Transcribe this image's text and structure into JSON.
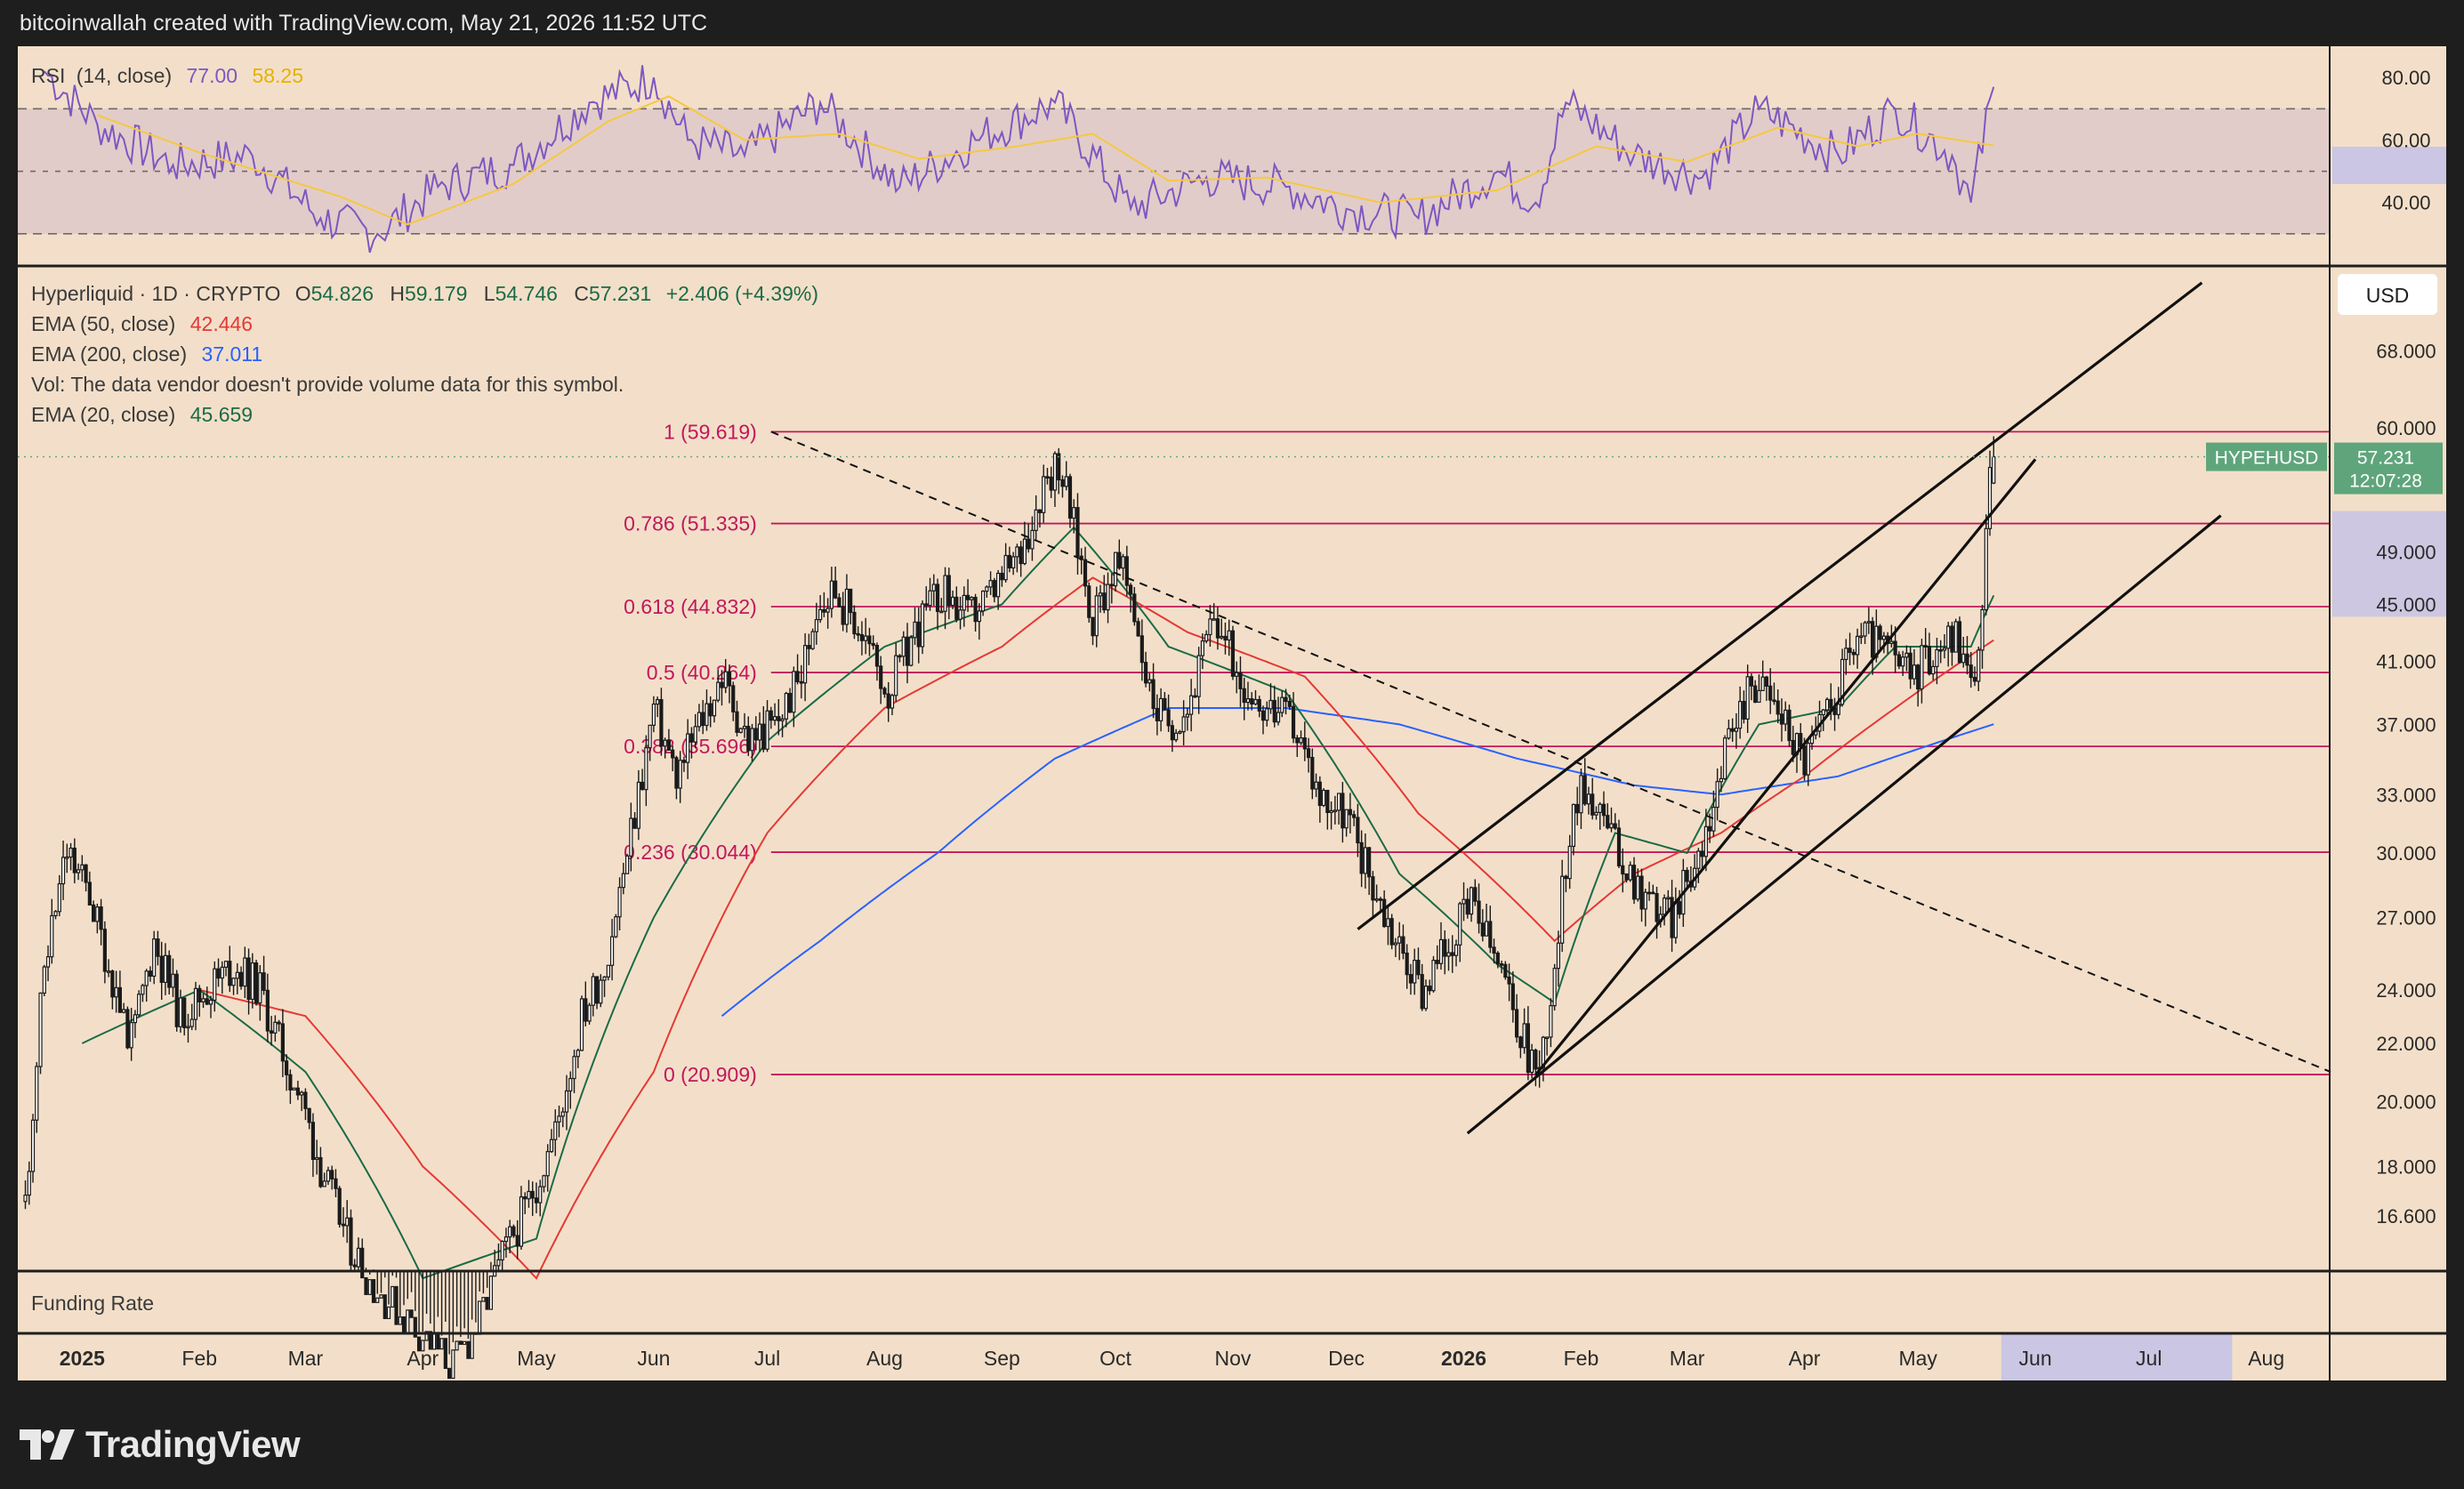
{
  "header": {
    "credit": "bitcoinwallah created with TradingView.com, May 21, 2026 11:52 UTC"
  },
  "footer": {
    "brand": "TradingView"
  },
  "colors": {
    "background": "#f3dfc9",
    "rsi": "#7e57c2",
    "rsi_ma": "#f5c842",
    "ema50": "#e53935",
    "ema200": "#2962ff",
    "ema20": "#1b6b47",
    "fib": "#c2185b",
    "price_label": "#5fa57c",
    "highlight": "#c5c3e6"
  },
  "rsi_panel": {
    "label": "RSI",
    "params": "(14, close)",
    "value": "77.00",
    "ma_value": "58.25",
    "ticks": [
      "80.00",
      "60.00",
      "40.00"
    ]
  },
  "price_panel": {
    "symbol": "Hyperliquid · 1D · CRYPTO",
    "open_label": "O",
    "open": "54.826",
    "high_label": "H",
    "high": "59.179",
    "low_label": "L",
    "low": "54.746",
    "close_label": "C",
    "close": "57.231",
    "change": "+2.406 (+4.39%)",
    "ema50_label": "EMA (50, close)",
    "ema50_value": "42.446",
    "ema200_label": "EMA (200, close)",
    "ema200_value": "37.011",
    "vol_note": "Vol: The data vendor doesn't provide volume data for this symbol.",
    "ema20_label": "EMA (20, close)",
    "ema20_value": "45.659",
    "currency": "USD",
    "ticker_label": "HYPEHUSD",
    "last_price": "57.231",
    "countdown": "12:07:28"
  },
  "funding_panel": {
    "label": "Funding Rate"
  },
  "time_axis": {
    "labels": [
      "2025",
      "Feb",
      "Mar",
      "Apr",
      "May",
      "Jun",
      "Jul",
      "Aug",
      "Sep",
      "Oct",
      "Nov",
      "Dec",
      "2026",
      "Feb",
      "Mar",
      "Apr",
      "May",
      "Jun",
      "Jul",
      "Aug"
    ]
  },
  "chart_data": {
    "type": "candlestick",
    "symbol": "HYPEHUSD",
    "interval": "1D",
    "y_scale": "log",
    "ylim": [
      15.2,
      78
    ],
    "xlim": [
      "2024-12-15",
      "2026-08-18"
    ],
    "price_ticks": [
      "68.000",
      "60.000",
      "49.000",
      "45.000",
      "41.000",
      "37.000",
      "33.000",
      "30.000",
      "27.000",
      "24.000",
      "22.000",
      "20.000",
      "18.000",
      "16.600"
    ],
    "fib_levels": [
      {
        "label": "1 (59.619)",
        "value": 59.619
      },
      {
        "label": "0.786 (51.335)",
        "value": 51.335
      },
      {
        "label": "0.618 (44.832)",
        "value": 44.832
      },
      {
        "label": "0.5 (40.264)",
        "value": 40.264
      },
      {
        "label": "0.382 (35.696)",
        "value": 35.696
      },
      {
        "label": "0.236 (30.044)",
        "value": 30.044
      },
      {
        "label": "0 (20.909)",
        "value": 20.909
      }
    ],
    "fib_range": [
      "2025-07-02",
      "2026-08-18"
    ],
    "close_series": [
      [
        "2024-12-17",
        17
      ],
      [
        "2024-12-22",
        25
      ],
      [
        "2024-12-28",
        30
      ],
      [
        "2025-01-03",
        28
      ],
      [
        "2025-01-08",
        25
      ],
      [
        "2025-01-14",
        22
      ],
      [
        "2025-01-20",
        26
      ],
      [
        "2025-01-27",
        23
      ],
      [
        "2025-02-03",
        24
      ],
      [
        "2025-02-10",
        25
      ],
      [
        "2025-02-17",
        24
      ],
      [
        "2025-02-22",
        22
      ],
      [
        "2025-02-28",
        20
      ],
      [
        "2025-03-05",
        18
      ],
      [
        "2025-03-12",
        16
      ],
      [
        "2025-03-19",
        14.8
      ],
      [
        "2025-03-26",
        14.2
      ],
      [
        "2025-04-02",
        13.6
      ],
      [
        "2025-04-09",
        13
      ],
      [
        "2025-04-16",
        14
      ],
      [
        "2025-04-22",
        15.5
      ],
      [
        "2025-04-29",
        17
      ],
      [
        "2025-05-06",
        19
      ],
      [
        "2025-05-13",
        23
      ],
      [
        "2025-05-19",
        25
      ],
      [
        "2025-05-24",
        29
      ],
      [
        "2025-05-28",
        33
      ],
      [
        "2025-06-01",
        38
      ],
      [
        "2025-06-07",
        34
      ],
      [
        "2025-06-13",
        37
      ],
      [
        "2025-06-19",
        40
      ],
      [
        "2025-06-26",
        36
      ],
      [
        "2025-07-03",
        37
      ],
      [
        "2025-07-10",
        40
      ],
      [
        "2025-07-14",
        45
      ],
      [
        "2025-07-19",
        46
      ],
      [
        "2025-07-26",
        43
      ],
      [
        "2025-08-02",
        39
      ],
      [
        "2025-08-09",
        43
      ],
      [
        "2025-08-16",
        46
      ],
      [
        "2025-08-23",
        44
      ],
      [
        "2025-08-30",
        46
      ],
      [
        "2025-09-06",
        49
      ],
      [
        "2025-09-12",
        55
      ],
      [
        "2025-09-16",
        57
      ],
      [
        "2025-09-20",
        51
      ],
      [
        "2025-09-25",
        44
      ],
      [
        "2025-10-01",
        48
      ],
      [
        "2025-10-05",
        46
      ],
      [
        "2025-10-10",
        39
      ],
      [
        "2025-10-14",
        37
      ],
      [
        "2025-10-20",
        38
      ],
      [
        "2025-10-27",
        44
      ],
      [
        "2025-11-03",
        40
      ],
      [
        "2025-11-10",
        38
      ],
      [
        "2025-11-17",
        37
      ],
      [
        "2025-11-24",
        33
      ],
      [
        "2025-12-01",
        32
      ],
      [
        "2025-12-07",
        29
      ],
      [
        "2025-12-14",
        26
      ],
      [
        "2025-12-21",
        24
      ],
      [
        "2025-12-28",
        26
      ],
      [
        "2026-01-03",
        27.5
      ],
      [
        "2026-01-10",
        25
      ],
      [
        "2026-01-17",
        22
      ],
      [
        "2026-01-21",
        21
      ],
      [
        "2026-01-25",
        25
      ],
      [
        "2026-01-30",
        33
      ],
      [
        "2026-02-04",
        33
      ],
      [
        "2026-02-11",
        30
      ],
      [
        "2026-02-18",
        28
      ],
      [
        "2026-02-25",
        27
      ],
      [
        "2026-03-04",
        30
      ],
      [
        "2026-03-11",
        35
      ],
      [
        "2026-03-18",
        40
      ],
      [
        "2026-03-25",
        38
      ],
      [
        "2026-04-01",
        35
      ],
      [
        "2026-04-08",
        38
      ],
      [
        "2026-04-15",
        43
      ],
      [
        "2026-04-22",
        42
      ],
      [
        "2026-04-29",
        40
      ],
      [
        "2026-05-06",
        42
      ],
      [
        "2026-05-11",
        43
      ],
      [
        "2026-05-15",
        39.5
      ],
      [
        "2026-05-18",
        44
      ],
      [
        "2026-05-19",
        50
      ],
      [
        "2026-05-20",
        54.8
      ],
      [
        "2026-05-21",
        57.231
      ]
    ],
    "ema20": [
      [
        "2025-01-01",
        22
      ],
      [
        "2025-02-01",
        24
      ],
      [
        "2025-03-01",
        21
      ],
      [
        "2025-04-01",
        15
      ],
      [
        "2025-05-01",
        16
      ],
      [
        "2025-06-01",
        27
      ],
      [
        "2025-07-01",
        36
      ],
      [
        "2025-08-01",
        42
      ],
      [
        "2025-09-01",
        45
      ],
      [
        "2025-09-20",
        51
      ],
      [
        "2025-10-15",
        42
      ],
      [
        "2025-11-15",
        39
      ],
      [
        "2025-12-15",
        29
      ],
      [
        "2026-01-10",
        25
      ],
      [
        "2026-01-25",
        23.5
      ],
      [
        "2026-02-10",
        31
      ],
      [
        "2026-03-01",
        30
      ],
      [
        "2026-03-20",
        37
      ],
      [
        "2026-04-10",
        38
      ],
      [
        "2026-04-25",
        42
      ],
      [
        "2026-05-15",
        42
      ],
      [
        "2026-05-21",
        45.659
      ]
    ],
    "ema50": [
      [
        "2025-02-01",
        24
      ],
      [
        "2025-03-01",
        23
      ],
      [
        "2025-04-01",
        18
      ],
      [
        "2025-05-01",
        15
      ],
      [
        "2025-06-01",
        21
      ],
      [
        "2025-07-01",
        31
      ],
      [
        "2025-08-01",
        38
      ],
      [
        "2025-09-01",
        42
      ],
      [
        "2025-09-25",
        47
      ],
      [
        "2025-10-20",
        43
      ],
      [
        "2025-11-20",
        40
      ],
      [
        "2025-12-20",
        32
      ],
      [
        "2026-01-25",
        26
      ],
      [
        "2026-02-15",
        29
      ],
      [
        "2026-03-10",
        31
      ],
      [
        "2026-04-01",
        34
      ],
      [
        "2026-04-25",
        38
      ],
      [
        "2026-05-21",
        42.446
      ]
    ],
    "ema200": [
      [
        "2025-06-19",
        23
      ],
      [
        "2025-07-15",
        26
      ],
      [
        "2025-08-15",
        30
      ],
      [
        "2025-09-15",
        35
      ],
      [
        "2025-10-15",
        38
      ],
      [
        "2025-11-15",
        38
      ],
      [
        "2025-12-15",
        37
      ],
      [
        "2026-01-15",
        35
      ],
      [
        "2026-02-15",
        33.5
      ],
      [
        "2026-03-10",
        33
      ],
      [
        "2026-04-10",
        34
      ],
      [
        "2026-05-21",
        37.011
      ]
    ],
    "rsi_series": [
      [
        "2024-12-22",
        82
      ],
      [
        "2025-01-05",
        65
      ],
      [
        "2025-01-25",
        52
      ],
      [
        "2025-02-15",
        55
      ],
      [
        "2025-03-05",
        35
      ],
      [
        "2025-03-20",
        30
      ],
      [
        "2025-04-05",
        45
      ],
      [
        "2025-04-25",
        52
      ],
      [
        "2025-05-15",
        72
      ],
      [
        "2025-06-01",
        80
      ],
      [
        "2025-06-10",
        60
      ],
      [
        "2025-06-25",
        55
      ],
      [
        "2025-07-15",
        72
      ],
      [
        "2025-08-05",
        45
      ],
      [
        "2025-08-25",
        60
      ],
      [
        "2025-09-15",
        72
      ],
      [
        "2025-10-05",
        38
      ],
      [
        "2025-10-25",
        48
      ],
      [
        "2025-11-15",
        45
      ],
      [
        "2025-12-01",
        38
      ],
      [
        "2025-12-20",
        35
      ],
      [
        "2026-01-10",
        50
      ],
      [
        "2026-01-20",
        40
      ],
      [
        "2026-01-28",
        72
      ],
      [
        "2026-02-15",
        55
      ],
      [
        "2026-03-05",
        48
      ],
      [
        "2026-03-20",
        70
      ],
      [
        "2026-04-10",
        55
      ],
      [
        "2026-04-25",
        70
      ],
      [
        "2026-05-10",
        55
      ],
      [
        "2026-05-15",
        40
      ],
      [
        "2026-05-21",
        77
      ]
    ],
    "rsi_ma_series": [
      [
        "2025-01-05",
        68
      ],
      [
        "2025-02-01",
        56
      ],
      [
        "2025-03-10",
        42
      ],
      [
        "2025-03-28",
        33
      ],
      [
        "2025-04-25",
        46
      ],
      [
        "2025-05-20",
        66
      ],
      [
        "2025-06-05",
        74
      ],
      [
        "2025-06-25",
        60
      ],
      [
        "2025-07-20",
        62
      ],
      [
        "2025-08-10",
        54
      ],
      [
        "2025-09-05",
        58
      ],
      [
        "2025-09-25",
        62
      ],
      [
        "2025-10-15",
        47
      ],
      [
        "2025-11-10",
        48
      ],
      [
        "2025-12-10",
        40
      ],
      [
        "2026-01-10",
        44
      ],
      [
        "2026-02-05",
        58
      ],
      [
        "2026-03-01",
        53
      ],
      [
        "2026-03-25",
        64
      ],
      [
        "2026-04-15",
        58
      ],
      [
        "2026-05-01",
        62
      ],
      [
        "2026-05-21",
        58.25
      ]
    ],
    "rsi_ylim": [
      20,
      90
    ],
    "rsi_bands": [
      70,
      50,
      30
    ],
    "drawings": {
      "channel_upper": [
        [
          "2025-12-04",
          26.5
        ],
        [
          "2026-07-15",
          76
        ]
      ],
      "channel_middle": [
        [
          "2026-01-20",
          20.9
        ],
        [
          "2026-06-01",
          57
        ]
      ],
      "channel_lower": [
        [
          "2026-01-02",
          19
        ],
        [
          "2026-07-20",
          52
        ]
      ],
      "downtrend": [
        [
          "2025-07-02",
          59.619
        ],
        [
          "2026-08-18",
          21
        ]
      ]
    }
  }
}
